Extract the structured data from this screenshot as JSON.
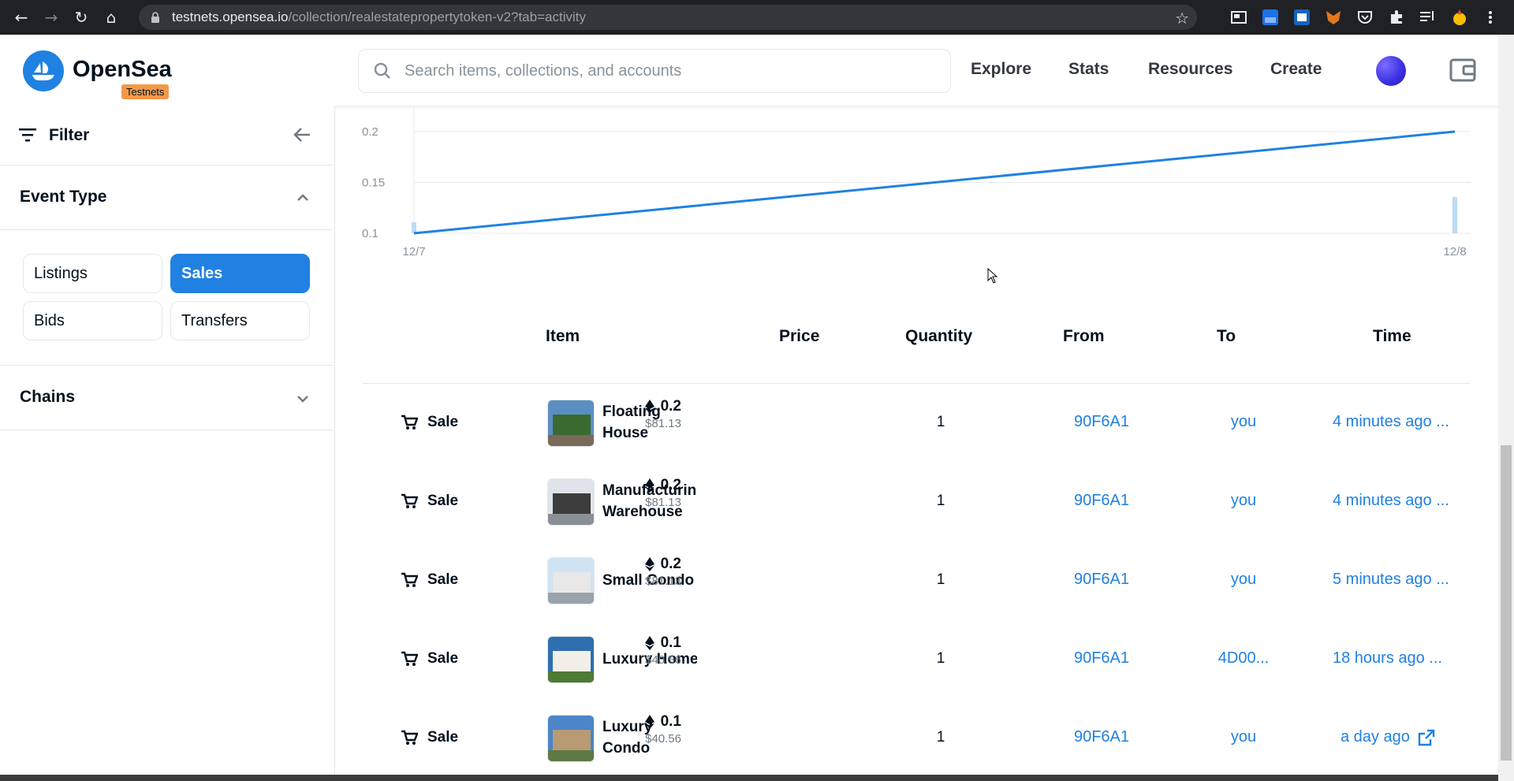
{
  "browser": {
    "url_host": "testnets.opensea.io",
    "url_path": "/collection/realestatepropertytoken-v2?tab=activity"
  },
  "header": {
    "brand": "OpenSea",
    "badge": "Testnets",
    "search_placeholder": "Search items, collections, and accounts",
    "nav": [
      "Explore",
      "Stats",
      "Resources",
      "Create"
    ]
  },
  "sidebar": {
    "filter_label": "Filter",
    "event_type_label": "Event Type",
    "event_types": [
      {
        "label": "Listings",
        "active": false
      },
      {
        "label": "Sales",
        "active": true
      },
      {
        "label": "Bids",
        "active": false
      },
      {
        "label": "Transfers",
        "active": false
      }
    ],
    "chains_label": "Chains"
  },
  "chart_data": {
    "type": "line",
    "x": [
      "12/7",
      "12/8"
    ],
    "y": [
      0.1,
      0.2
    ],
    "yticks": [
      "0.1",
      "0.15",
      "0.2"
    ],
    "ylim": [
      0.1,
      0.2
    ],
    "line_color": "#2081e2"
  },
  "table": {
    "headers": [
      "Item",
      "Price",
      "Quantity",
      "From",
      "To",
      "Time"
    ],
    "rows": [
      {
        "event": "Sale",
        "item_line1": "Floating",
        "item_line2": "House",
        "price": "0.2",
        "usd": "$81.13",
        "qty": "1",
        "from": "90F6A1",
        "to": "you",
        "time": "4 minutes ago ..."
      },
      {
        "event": "Sale",
        "item_line1": "Manufacturin",
        "item_line2": "Warehouse",
        "price": "0.2",
        "usd": "$81.13",
        "qty": "1",
        "from": "90F6A1",
        "to": "you",
        "time": "4 minutes ago ..."
      },
      {
        "event": "Sale",
        "item_line1": "Small Condo",
        "item_line2": "",
        "price": "0.2",
        "usd": "$81.13",
        "qty": "1",
        "from": "90F6A1",
        "to": "you",
        "time": "5 minutes ago ..."
      },
      {
        "event": "Sale",
        "item_line1": "Luxury Home",
        "item_line2": "",
        "price": "0.1",
        "usd": "$40.56",
        "qty": "1",
        "from": "90F6A1",
        "to": "4D00...",
        "time": "18 hours ago ..."
      },
      {
        "event": "Sale",
        "item_line1": "Luxury",
        "item_line2": "Condo",
        "price": "0.1",
        "usd": "$40.56",
        "qty": "1",
        "from": "90F6A1",
        "to": "you",
        "time": "a day ago"
      }
    ]
  },
  "colors": {
    "accent": "#2081e2",
    "badge": "#f2994a",
    "chrome": "#202124"
  }
}
